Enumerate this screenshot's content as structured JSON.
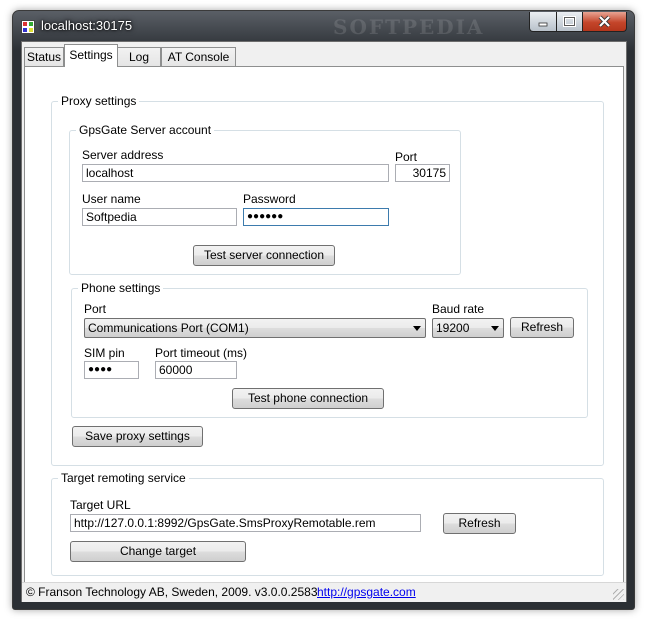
{
  "window": {
    "title": "localhost:30175",
    "watermark": "SOFTPEDIA"
  },
  "tabs": [
    "Status",
    "Settings",
    "Log",
    "AT Console"
  ],
  "proxy": {
    "group_label": "Proxy settings",
    "server": {
      "group_label": "GpsGate Server account",
      "address_label": "Server address",
      "address_value": "localhost",
      "port_label": "Port",
      "port_value": "30175",
      "user_label": "User name",
      "user_value": "Softpedia",
      "password_label": "Password",
      "password_value": "●●●●●●",
      "test_button": "Test server connection"
    },
    "phone": {
      "group_label": "Phone settings",
      "port_label": "Port",
      "port_value": "Communications Port (COM1)",
      "baud_label": "Baud rate",
      "baud_value": "19200",
      "refresh_button": "Refresh",
      "sim_label": "SIM pin",
      "sim_value": "●●●●",
      "timeout_label": "Port timeout (ms)",
      "timeout_value": "60000",
      "test_button": "Test phone connection"
    },
    "save_button": "Save proxy settings"
  },
  "target": {
    "group_label": "Target remoting service",
    "url_label": "Target URL",
    "url_value": "http://127.0.0.1:8992/GpsGate.SmsProxyRemotable.rem",
    "refresh_button": "Refresh",
    "change_button": "Change target"
  },
  "status_bar": {
    "text": "© Franson Technology AB, Sweden, 2009.  v3.0.0.2583",
    "link": "http://gpsgate.com"
  }
}
